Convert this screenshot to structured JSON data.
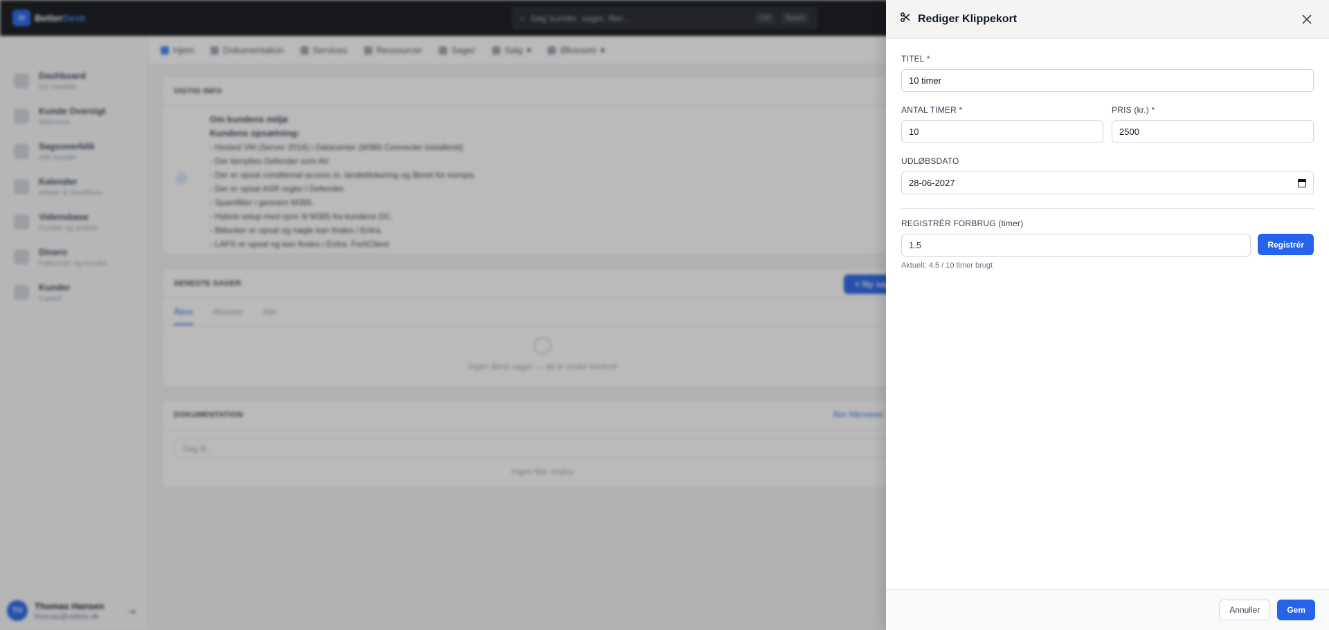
{
  "app": {
    "logo_prefix": "Better",
    "logo_suffix": "Desk",
    "search_placeholder": "Søg kunder, sager, filer...",
    "search_kbd_1": "Ctrl",
    "search_kbd_2": "Space"
  },
  "sidebar": {
    "items": [
      {
        "title": "Dashboard",
        "sub": "Dit overblik"
      },
      {
        "title": "Kunde Oversigt",
        "sub": "Welcome"
      },
      {
        "title": "Sagsoverblik",
        "sub": "Alle kunder"
      },
      {
        "title": "Kalender",
        "sub": "Aftaler & deadlines"
      },
      {
        "title": "Vidensbase",
        "sub": "Guides og artikler"
      },
      {
        "title": "Dinero",
        "sub": "Fakturaer og kunder"
      },
      {
        "title": "Kunder",
        "sub": "Castell"
      }
    ],
    "user": {
      "initials": "TH",
      "name": "Thomas Hansen",
      "email": "thomas@valetis.dk"
    }
  },
  "nav": {
    "items": [
      "Hjem",
      "Dokumentation",
      "Services",
      "Ressourcer",
      "Sager",
      "Salg",
      "Økonomi"
    ]
  },
  "info_card": {
    "title": "VIGTIG INFO",
    "heading": "Om kundens miljø",
    "subheading": "Kundens opsætning:",
    "lines": [
      "- Hosted VM (Server 2016) i Datacenter (M365 Connecter installeret)",
      "- Der benyttes Defender som AV.",
      "- Der er opsat conditional access m. landeblokering og åbnet for europa.",
      "- Der er opsat ASR regler i Defender.",
      "- Spamfilter i gennem M365.",
      "- Hybrid setup med sync til M365 fra kundens DC.",
      "- Bitlocker er opsat og nøgle kan findes i Entra.",
      "- LAPS er opsat og kan findes i Entra. FortiClient"
    ]
  },
  "cases_card": {
    "title": "SENESTE SAGER",
    "new_button": "+ Ny sag",
    "tabs": [
      "Åbne",
      "Afventer",
      "Alle"
    ],
    "empty_text": "Ingen åbne sager — alt er under kontrol!"
  },
  "docs_card": {
    "title": "DOKUMENTATION",
    "link": "Åbn filbrowser",
    "search_placeholder": "Søg fil...",
    "empty_text": "Ingen filer endnu"
  },
  "drawer": {
    "title": "Rediger Klippekort",
    "fields": {
      "title_label": "TITEL *",
      "title_value": "10 timer",
      "hours_label": "ANTAL TIMER *",
      "hours_value": "10",
      "price_label": "PRIS (kr.) *",
      "price_value": "2500",
      "expiry_label": "UDLØBSDATO",
      "expiry_value": "28-06-2027",
      "usage_label": "REGISTRÉR FORBRUG (timer)",
      "usage_value": "1.5",
      "usage_hint": "Aktuelt: 4,5 / 10 timer brugt"
    },
    "register_button": "Registrér",
    "cancel_button": "Annuller",
    "save_button": "Gem"
  },
  "colors": {
    "accent": "#2563eb",
    "overlay": "rgba(40,40,40,0.32)"
  }
}
